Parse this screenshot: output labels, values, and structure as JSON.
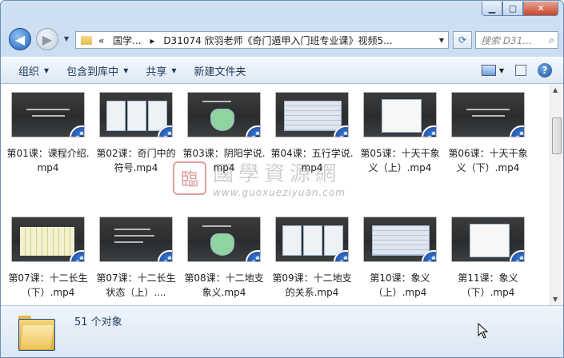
{
  "window": {
    "caption_buttons": [
      {
        "name": "minimize-button",
        "glyph": "▁"
      },
      {
        "name": "maximize-button",
        "glyph": "▢"
      },
      {
        "name": "close-button",
        "glyph": "✕"
      }
    ]
  },
  "nav": {
    "back_glyph": "◀",
    "forward_glyph": "▶",
    "breadcrumb": [
      "«",
      "国学...",
      "▸",
      "D31074 欣羽老师《奇门遁甲入门班专业课》视频5..."
    ],
    "search_placeholder": "搜索 D31...",
    "refresh_glyph": "⟳"
  },
  "toolbar": {
    "items": [
      "组织",
      "包含到库中",
      "共享",
      "新建文件夹"
    ],
    "has_dropdown": [
      true,
      true,
      true,
      false
    ],
    "help_glyph": "?"
  },
  "files": [
    {
      "name": "第01课：课程介绍.mp4",
      "thumb": "title"
    },
    {
      "name": "第02课：奇门中的符号.mp4",
      "thumb": "cards"
    },
    {
      "name": "第03课：阴阳学说.mp4",
      "thumb": "shape"
    },
    {
      "name": "第04课：五行学说.mp4",
      "thumb": "table"
    },
    {
      "name": "第05课：十天干象义（上）.mp4",
      "thumb": "doc"
    },
    {
      "name": "第06课：十天干象义（下）.mp4",
      "thumb": "title"
    },
    {
      "name": "第07课：十二长生（下）.mp4",
      "thumb": "grid"
    },
    {
      "name": "第07课：十二长生状态（上）....",
      "thumb": "lines"
    },
    {
      "name": "第08课：十二地支象义.mp4",
      "thumb": "shape"
    },
    {
      "name": "第09课：十二地支的关系.mp4",
      "thumb": "cards"
    },
    {
      "name": "第10课：象义（上）.mp4",
      "thumb": "table"
    },
    {
      "name": "第11课：象义（下）.mp4",
      "thumb": "doc"
    }
  ],
  "watermark": {
    "seal": "臨",
    "text": "國學資源網",
    "url": "www.guoxueziyuan.com"
  },
  "status": {
    "count": "51 个对象"
  }
}
